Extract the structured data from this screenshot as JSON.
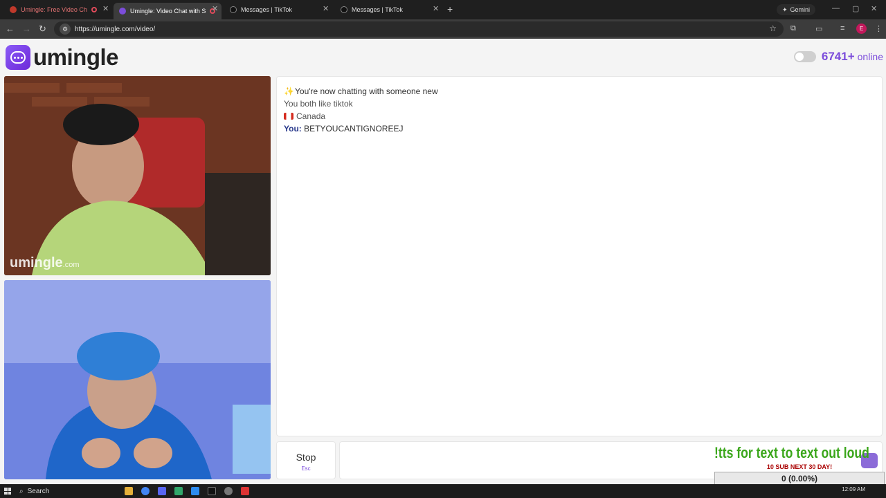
{
  "browser": {
    "tabs": [
      {
        "title": "Umingle: Free Video Ch",
        "active": false,
        "favicon_color": "#c0392b"
      },
      {
        "title": "Umingle: Video Chat with S",
        "active": true,
        "favicon_color": "#7c4ddb"
      },
      {
        "title": "Messages | TikTok",
        "active": false,
        "favicon_color": "#111111"
      },
      {
        "title": "Messages | TikTok",
        "active": false,
        "favicon_color": "#111111"
      }
    ],
    "new_tab": "+",
    "gemini_label": "Gemini",
    "url": "https://umingle.com/video/",
    "profile_initial": "E"
  },
  "site": {
    "logo_text": "umingle",
    "online_count": "6741+",
    "online_label": "online",
    "toggle_on": false
  },
  "videos": {
    "watermark_main": "umingle",
    "watermark_suffix": ".com"
  },
  "chat": {
    "system_message": "You're now chatting with someone new",
    "interest_message": "You both like tiktok",
    "country": "Canada",
    "you_label": "You:",
    "you_message": "BETYOUCANTIGNOREEJ"
  },
  "controls": {
    "stop_label": "Stop",
    "stop_shortcut": "Esc"
  },
  "overlay": {
    "tts_text": "!tts for text to text out loud",
    "sub_goal": "10 SUB NEXT 30 DAY!",
    "progress_text": "0 (0.00%)"
  },
  "taskbar": {
    "search_label": "Search",
    "time": "12:09 AM"
  },
  "colors": {
    "accent": "#7c4ddb",
    "tts_green": "#3aa61a"
  }
}
